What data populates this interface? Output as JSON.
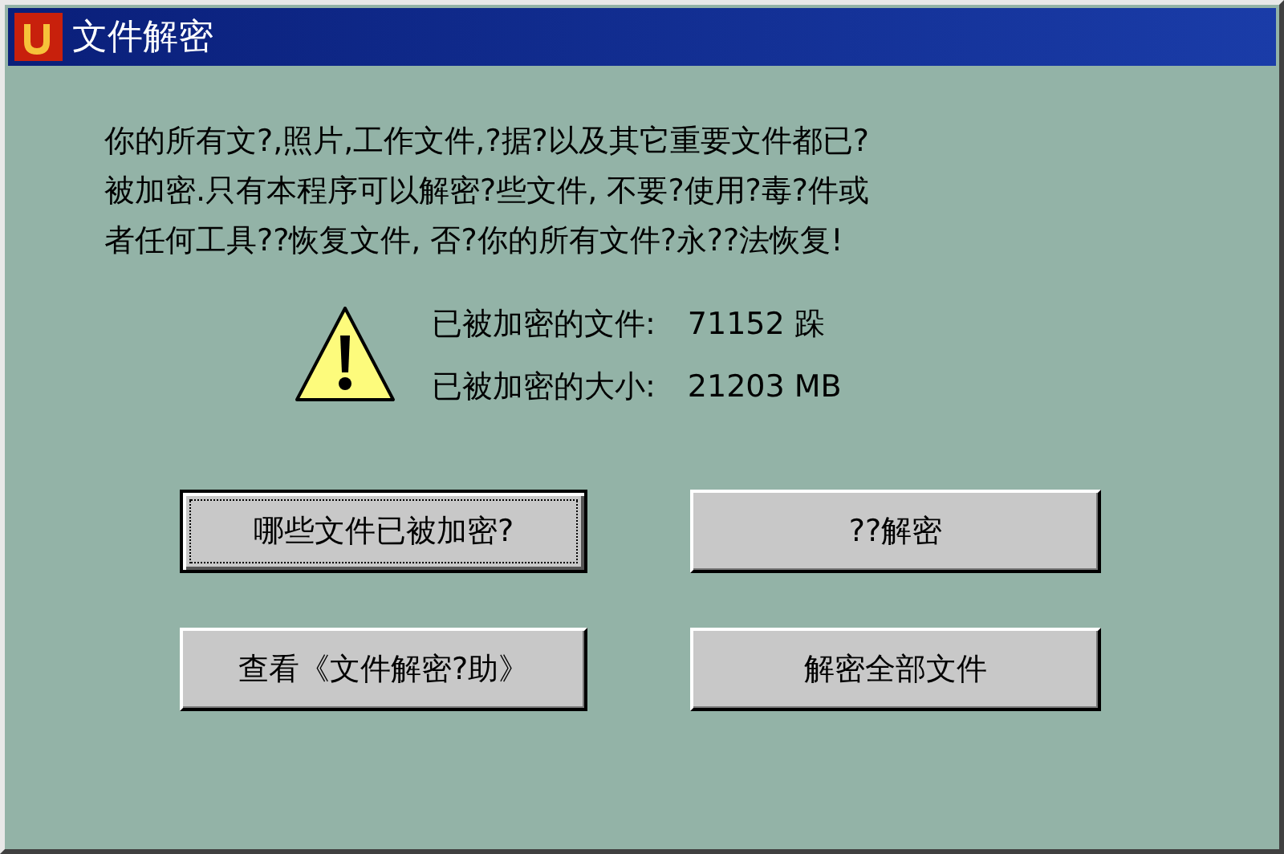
{
  "window": {
    "title": "文件解密"
  },
  "message_lines": [
    "你的所有文?,照片,工作文件,?据?以及其它重要文件都已?",
    "被加密.只有本程序可以解密?些文件, 不要?使用?毒?件或",
    "者任何工具??恢复文件, 否?你的所有文件?永??法恢复!"
  ],
  "stats": [
    {
      "label": "已被加密的文件:",
      "value": "71152 跺"
    },
    {
      "label": "已被加密的大小:",
      "value": "21203 MB"
    }
  ],
  "buttons": [
    {
      "label": "哪些文件已被加密?",
      "focused": true
    },
    {
      "label": "??解密",
      "focused": false
    },
    {
      "label": "查看《文件解密?助》",
      "focused": false
    },
    {
      "label": "解密全部文件",
      "focused": false
    }
  ]
}
